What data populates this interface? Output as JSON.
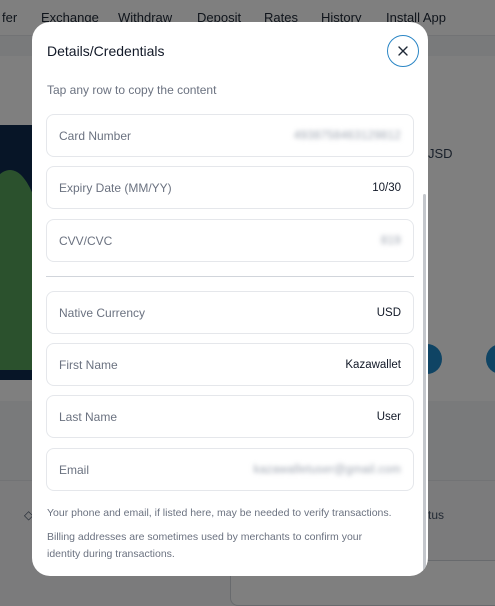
{
  "background": {
    "nav": {
      "items": [
        "fer",
        "Exchange",
        "Withdraw",
        "Deposit",
        "Rates",
        "History",
        "Install App"
      ]
    },
    "currency_fragment": "JSD",
    "lower_tab_fragment": "◇",
    "status_fragment": "tus"
  },
  "modal": {
    "title": "Details/Credentials",
    "close_icon": "close-icon",
    "hint": "Tap any row to copy the content",
    "rows": [
      {
        "label": "Card Number",
        "value": "4938758463129812"
      },
      {
        "label": "Expiry Date (MM/YY)",
        "value": "10/30"
      },
      {
        "label": "CVV/CVC",
        "value": "819"
      },
      {
        "label": "Native Currency",
        "value": "USD"
      },
      {
        "label": "First Name",
        "value": "Kazawallet"
      },
      {
        "label": "Last Name",
        "value": "User"
      },
      {
        "label": "Email",
        "value": "kazawalletuser@gmail.com"
      }
    ],
    "note_1": "Your phone and email, if listed here, may be needed to verify transactions.",
    "note_2": "Billing addresses are sometimes used by merchants to confirm your identity during transactions."
  },
  "colors": {
    "accent": "#2b86c5",
    "overlay": "rgba(0,0,0,0.5)"
  }
}
